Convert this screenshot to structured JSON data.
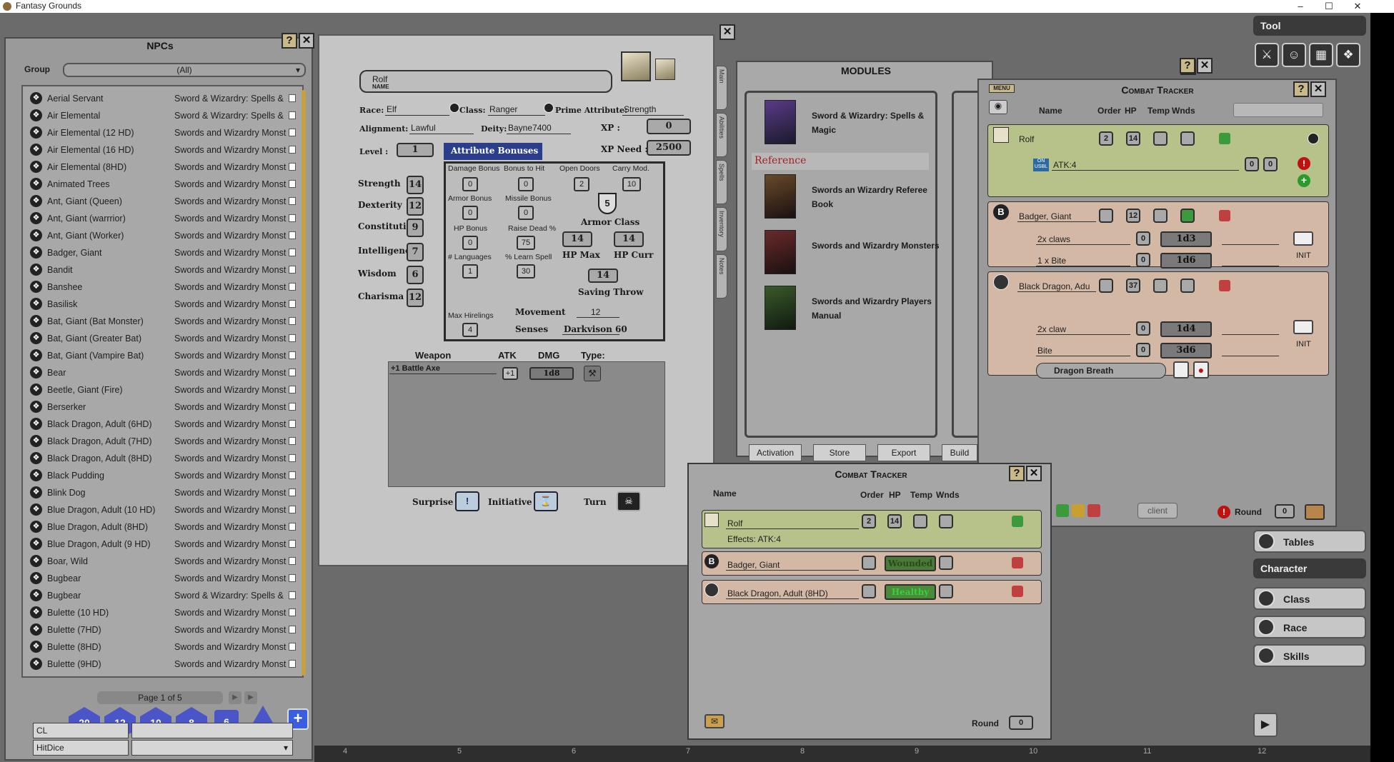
{
  "app": {
    "title": "Fantasy Grounds"
  },
  "npcs": {
    "title": "NPCs",
    "group_label": "Group",
    "group_value": "(All)",
    "page_text": "Page 1 of 5",
    "items": [
      {
        "name": "Aerial Servant",
        "source": "Sword & Wizardry: Spells &"
      },
      {
        "name": "Air Elemental",
        "source": "Sword & Wizardry: Spells &"
      },
      {
        "name": "Air Elemental (12 HD)",
        "source": "Swords and Wizardry Monst"
      },
      {
        "name": "Air Elemental (16 HD)",
        "source": "Swords and Wizardry Monst"
      },
      {
        "name": "Air Elemental (8HD)",
        "source": "Swords and Wizardry Monst"
      },
      {
        "name": "Animated Trees",
        "source": "Swords and Wizardry Monst"
      },
      {
        "name": "Ant, Giant (Queen)",
        "source": "Swords and Wizardry Monst"
      },
      {
        "name": "Ant, Giant (warrrior)",
        "source": "Swords and Wizardry Monst"
      },
      {
        "name": "Ant, Giant (Worker)",
        "source": "Swords and Wizardry Monst"
      },
      {
        "name": "Badger, Giant",
        "source": "Swords and Wizardry Monst"
      },
      {
        "name": "Bandit",
        "source": "Swords and Wizardry Monst"
      },
      {
        "name": "Banshee",
        "source": "Swords and Wizardry Monst"
      },
      {
        "name": "Basilisk",
        "source": "Swords and Wizardry Monst"
      },
      {
        "name": "Bat, Giant (Bat Monster)",
        "source": "Swords and Wizardry Monst"
      },
      {
        "name": "Bat, Giant (Greater Bat)",
        "source": "Swords and Wizardry Monst"
      },
      {
        "name": "Bat, Giant (Vampire Bat)",
        "source": "Swords and Wizardry Monst"
      },
      {
        "name": "Bear",
        "source": "Swords and Wizardry Monst"
      },
      {
        "name": "Beetle, Giant (Fire)",
        "source": "Swords and Wizardry Monst"
      },
      {
        "name": "Berserker",
        "source": "Swords and Wizardry Monst"
      },
      {
        "name": "Black Dragon, Adult  (6HD)",
        "source": "Swords and Wizardry Monst"
      },
      {
        "name": "Black Dragon, Adult  (7HD)",
        "source": "Swords and Wizardry Monst"
      },
      {
        "name": "Black Dragon, Adult (8HD)",
        "source": "Swords and Wizardry Monst"
      },
      {
        "name": "Black Pudding",
        "source": "Swords and Wizardry Monst"
      },
      {
        "name": "Blink Dog",
        "source": "Swords and Wizardry Monst"
      },
      {
        "name": "Blue Dragon, Adult (10 HD)",
        "source": "Swords and Wizardry Monst"
      },
      {
        "name": "Blue Dragon, Adult (8HD)",
        "source": "Swords and Wizardry Monst"
      },
      {
        "name": "Blue Dragon, Adult (9 HD)",
        "source": "Swords and Wizardry Monst"
      },
      {
        "name": "Boar, Wild",
        "source": "Swords and Wizardry Monst"
      },
      {
        "name": "Bugbear",
        "source": "Swords and Wizardry Monst"
      },
      {
        "name": "Bugbear",
        "source": "Sword & Wizardry: Spells &"
      },
      {
        "name": "Bulette (10 HD)",
        "source": "Swords and Wizardry Monst"
      },
      {
        "name": "Bulette (7HD)",
        "source": "Swords and Wizardry Monst"
      },
      {
        "name": "Bulette (8HD)",
        "source": "Swords and Wizardry Monst"
      },
      {
        "name": "Bulette (9HD)",
        "source": "Swords and Wizardry Monst"
      }
    ]
  },
  "dice": {
    "labels": [
      "20",
      "12",
      "10",
      "8",
      "6"
    ],
    "field1": "CL",
    "field2": "HitDice"
  },
  "character": {
    "name": "Rolf",
    "name_caption": "NAME",
    "race_label": "Race:",
    "race": "Elf",
    "class_label": "Class:",
    "class": "Ranger",
    "prime_label": "Prime Attribute:",
    "prime": "Strength",
    "alignment_label": "Alignment:",
    "alignment": "Lawful",
    "deity_label": "Deity:",
    "deity": "Bayne7400",
    "xp_label": "XP :",
    "xp": "0",
    "xpneed_label": "XP Need :",
    "xpneed": "2500",
    "level_label": "Level :",
    "level": "1",
    "bonus_header": "Attribute Bonuses",
    "attributes": [
      {
        "label": "Strength",
        "value": "14"
      },
      {
        "label": "Dexterity",
        "value": "12"
      },
      {
        "label": "Constitution",
        "value": "9"
      },
      {
        "label": "Intelligence",
        "value": "7"
      },
      {
        "label": "Wisdom",
        "value": "6"
      },
      {
        "label": "Charisma",
        "value": "12"
      }
    ],
    "bonuses": {
      "damage_label": "Damage Bonus",
      "damage": "0",
      "tohit_label": "Bonus to Hit",
      "tohit": "0",
      "doors_label": "Open Doors",
      "doors": "2",
      "carry_label": "Carry Mod.",
      "carry": "10",
      "armor_label": "Armor Bonus",
      "armor": "0",
      "missile_label": "Missile Bonus",
      "missile": "0",
      "hp_label": "HP Bonus",
      "hp": "0",
      "raise_label": "Raise Dead %",
      "raise": "75",
      "lang_label": "# Languages",
      "lang": "1",
      "learn_label": "% Learn Spell",
      "learn": "30",
      "hirelings_label": "Max Hirelings",
      "hirelings": "4"
    },
    "ac": "5",
    "ac_label": "Armor Class",
    "hpmax": "14",
    "hpmax_label": "HP Max",
    "hpcurr": "14",
    "hpcurr_label": "HP Curr",
    "save": "14",
    "save_label": "Saving Throw",
    "movement_label": "Movement",
    "movement": "12",
    "senses_label": "Senses",
    "senses": "Darkvison 60",
    "weapon_header": "Weapon",
    "atk_header": "ATK",
    "dmg_header": "DMG",
    "type_header": "Type:",
    "weapon": {
      "name": "+1 Battle Axe",
      "atk": "+1",
      "dmg": "1d8"
    },
    "surprise_label": "Surprise",
    "initiative_label": "Initiative",
    "turn_label": "Turn",
    "side_tabs": [
      "Main",
      "Abilities",
      "Spells",
      "Inventory",
      "Notes"
    ]
  },
  "modules": {
    "title": "MODULES",
    "reference_label": "Reference",
    "items": [
      {
        "title": "Sword & Wizardry: Spells & Magic"
      },
      {
        "title": "Swords an Wizardry Referee Book"
      },
      {
        "title": "Swords and Wizardry Monsters"
      },
      {
        "title": "Swords and Wizardry Players Manual"
      }
    ],
    "tabs": [
      "Activation",
      "Store",
      "Export",
      "Build"
    ]
  },
  "ct_gm": {
    "title": "Combat Tracker",
    "menu_label": "MENU",
    "headers": {
      "name": "Name",
      "order": "Order",
      "hp": "HP",
      "temp": "Temp",
      "wnds": "Wnds"
    },
    "rolf": {
      "name": "Rolf",
      "order": "2",
      "hp": "14",
      "effect_on": "ON",
      "effect_usbl": "USBL",
      "effect": "ATK:4",
      "effect_num1": "0",
      "effect_num2": "0"
    },
    "badger": {
      "name": "Badger, Giant",
      "hp": "12",
      "attacks": [
        {
          "name": "2x claws",
          "num": "0",
          "dmg": "1d3"
        },
        {
          "name": "1 x Bite",
          "num": "0",
          "dmg": "1d6"
        }
      ],
      "init_label": "INIT"
    },
    "dragon": {
      "name": "Black Dragon, Adu",
      "hp": "37",
      "attacks": [
        {
          "name": "2x claw",
          "num": "0",
          "dmg": "1d4"
        },
        {
          "name": "Bite",
          "num": "0",
          "dmg": "3d6"
        }
      ],
      "power": "Dragon Breath",
      "init_label": "INIT"
    },
    "footer": {
      "client_label": "client",
      "round_label": "Round",
      "round": "0"
    }
  },
  "ct_client": {
    "title": "Combat Tracker",
    "headers": {
      "name": "Name",
      "order": "Order",
      "hp": "HP",
      "temp": "Temp",
      "wnds": "Wnds"
    },
    "rolf": {
      "name": "Rolf",
      "order": "2",
      "hp": "14",
      "effects": "Effects: ATK:4"
    },
    "badger": {
      "name": "Badger, Giant",
      "status": "Wounded"
    },
    "dragon": {
      "name": "Black Dragon, Adult (8HD)",
      "status": "Healthy"
    },
    "round_label": "Round",
    "round": "0"
  },
  "sidebar": {
    "tool_header": "Tool",
    "tables": "Tables",
    "character_header": "Character",
    "items": [
      "Class",
      "Race",
      "Skills"
    ]
  },
  "ruler": [
    "4",
    "5",
    "6",
    "7",
    "8",
    "9",
    "10",
    "11",
    "12"
  ],
  "colors": {
    "player_row": "#b7c28a",
    "npc_row": "#d4b8a6",
    "accent_blue": "#2b3e8c"
  }
}
